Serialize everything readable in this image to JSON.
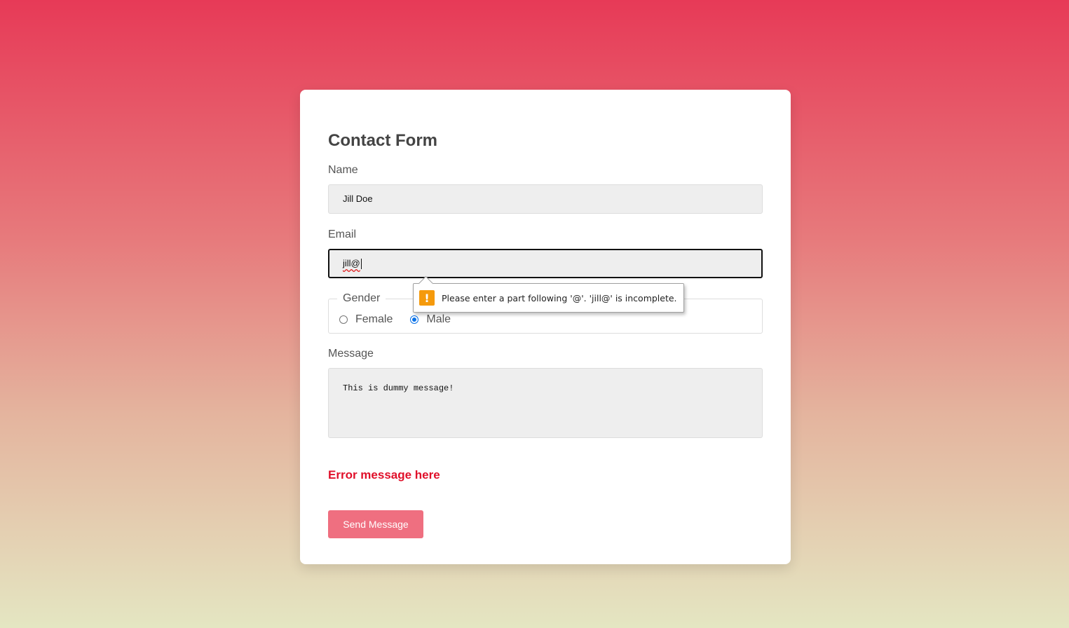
{
  "form": {
    "title": "Contact Form",
    "name": {
      "label": "Name",
      "value": "Jill Doe"
    },
    "email": {
      "label": "Email",
      "value": "jill@"
    },
    "gender": {
      "legend": "Gender",
      "options": [
        {
          "label": "Female",
          "checked": false
        },
        {
          "label": "Male",
          "checked": true
        }
      ]
    },
    "message": {
      "label": "Message",
      "value": "This is dummy message!"
    },
    "error_text": "Error message here",
    "submit_label": "Send Message"
  },
  "validation_tooltip": {
    "icon": "warning-icon",
    "icon_glyph": "!",
    "text": "Please enter a part following '@'. 'jill@' is incomplete."
  },
  "colors": {
    "accent": "#ef6f80",
    "error": "#e0102a",
    "radio_checked": "#0b72e7",
    "warning": "#f59a0c"
  }
}
